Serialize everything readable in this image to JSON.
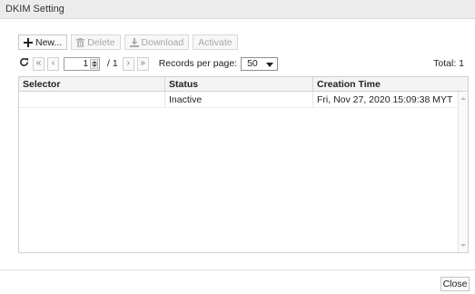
{
  "window": {
    "title": "DKIM Setting"
  },
  "toolbar": {
    "new_label": "New...",
    "delete_label": "Delete",
    "download_label": "Download",
    "activate_label": "Activate"
  },
  "pagination": {
    "current_page": "1",
    "of_label": "/ 1",
    "records_per_page_label": "Records per page:",
    "records_per_page_value": "50",
    "total_label": "Total: 1"
  },
  "table": {
    "columns": [
      "Selector",
      "Status",
      "Creation Time"
    ],
    "rows": [
      [
        "",
        "Inactive",
        "Fri, Nov 27, 2020 15:09:38 MYT"
      ]
    ]
  },
  "footer": {
    "close_label": "Close"
  },
  "icons": {
    "new": "plus-icon",
    "delete": "trash-icon",
    "download": "download-icon",
    "refresh": "refresh-icon",
    "first": "double-chevron-left-icon",
    "prev": "chevron-left-icon",
    "next": "chevron-right-icon",
    "last": "double-chevron-right-icon"
  }
}
